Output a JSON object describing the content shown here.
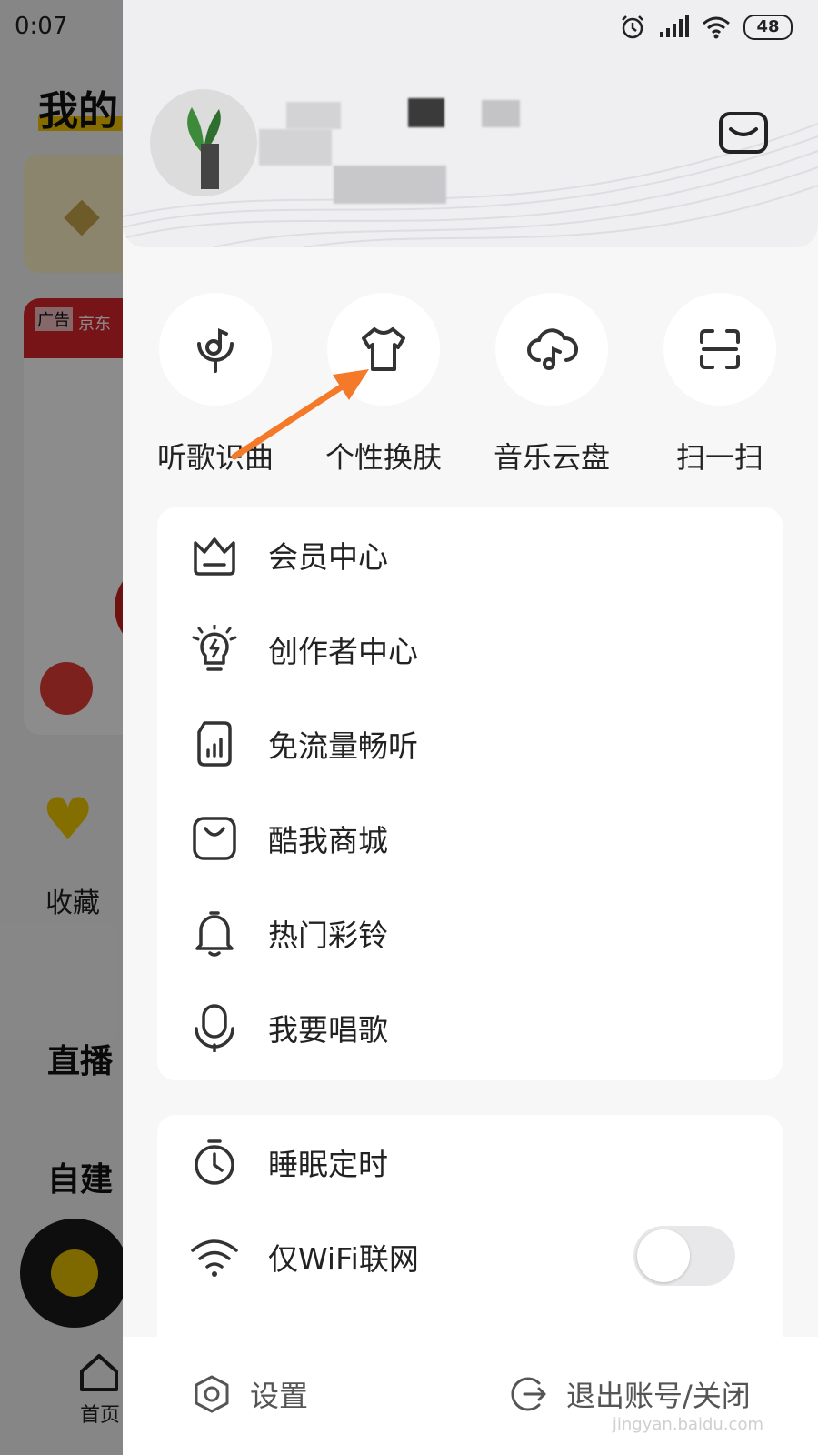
{
  "status_bar": {
    "time": "0:07",
    "battery": "48"
  },
  "background": {
    "title": "我的",
    "ad_tag": "广告",
    "ad_brand": "京东",
    "favorites_label": "收藏",
    "live_label": "直播",
    "build_label": "自建",
    "home_label": "首页"
  },
  "drawer": {
    "quick_actions": [
      {
        "label": "听歌识曲",
        "icon": "song-recognition-icon"
      },
      {
        "label": "个性换肤",
        "icon": "tshirt-icon"
      },
      {
        "label": "音乐云盘",
        "icon": "cloud-music-icon"
      },
      {
        "label": "扫一扫",
        "icon": "scan-icon"
      }
    ],
    "menu_primary": [
      {
        "label": "会员中心",
        "icon": "crown-icon"
      },
      {
        "label": "创作者中心",
        "icon": "lightbulb-icon"
      },
      {
        "label": "免流量畅听",
        "icon": "data-free-icon"
      },
      {
        "label": "酷我商城",
        "icon": "shopping-bag-icon"
      },
      {
        "label": "热门彩铃",
        "icon": "bell-icon"
      },
      {
        "label": "我要唱歌",
        "icon": "microphone-icon"
      }
    ],
    "menu_secondary": [
      {
        "label": "睡眠定时",
        "icon": "timer-icon"
      },
      {
        "label": "仅WiFi联网",
        "icon": "wifi-icon",
        "toggle": false
      }
    ],
    "bottom": {
      "settings": "设置",
      "logout": "退出账号/关闭"
    }
  },
  "watermark": "jingyan.baidu.com",
  "colors": {
    "arrow": "#f47a2a",
    "accent": "#f6c700"
  }
}
